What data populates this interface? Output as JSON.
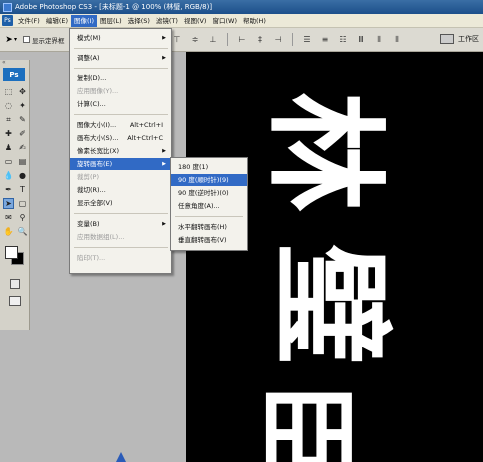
{
  "window": {
    "title": "Adobe Photoshop CS3 - [未标题-1 @ 100% (林璧, RGB/8)]"
  },
  "menubar": {
    "badge": "Ps",
    "items": [
      "文件(F)",
      "编辑(E)",
      "图像(I)",
      "图层(L)",
      "选择(S)",
      "滤镜(T)",
      "视图(V)",
      "窗口(W)",
      "帮助(H)"
    ]
  },
  "options": {
    "checkbox_label": "显示定界框",
    "workspace_label": "工作区"
  },
  "toolbox": {
    "logo": "Ps",
    "grip": "«"
  },
  "image_menu": {
    "items": [
      {
        "label": "模式(M)",
        "shortcut": "",
        "submenu": true,
        "disabled": false
      },
      {
        "label": "调整(A)",
        "shortcut": "",
        "submenu": true,
        "disabled": false
      },
      {
        "label": "复制(D)...",
        "shortcut": "",
        "submenu": false,
        "disabled": false
      },
      {
        "label": "应用图像(Y)...",
        "shortcut": "",
        "submenu": false,
        "disabled": true
      },
      {
        "label": "计算(C)...",
        "shortcut": "",
        "submenu": false,
        "disabled": false
      },
      {
        "label": "图像大小(I)...",
        "shortcut": "Alt+Ctrl+I",
        "submenu": false,
        "disabled": false
      },
      {
        "label": "画布大小(S)...",
        "shortcut": "Alt+Ctrl+C",
        "submenu": false,
        "disabled": false
      },
      {
        "label": "像素长宽比(X)",
        "shortcut": "",
        "submenu": true,
        "disabled": false
      },
      {
        "label": "旋转画布(E)",
        "shortcut": "",
        "submenu": true,
        "disabled": false,
        "active": true
      },
      {
        "label": "裁剪(P)",
        "shortcut": "",
        "submenu": false,
        "disabled": true
      },
      {
        "label": "裁切(R)...",
        "shortcut": "",
        "submenu": false,
        "disabled": false
      },
      {
        "label": "显示全部(V)",
        "shortcut": "",
        "submenu": false,
        "disabled": false
      },
      {
        "label": "变量(B)",
        "shortcut": "",
        "submenu": true,
        "disabled": false
      },
      {
        "label": "应用数据组(L)...",
        "shortcut": "",
        "submenu": false,
        "disabled": true
      },
      {
        "label": "陷印(T)...",
        "shortcut": "",
        "submenu": false,
        "disabled": true
      }
    ]
  },
  "rotate_submenu": {
    "items": [
      {
        "label": "180 度(1)",
        "active": false
      },
      {
        "label": "90 度(顺时针)(9)",
        "active": true
      },
      {
        "label": "90 度(逆时针)(0)",
        "active": false
      },
      {
        "label": "任意角度(A)...",
        "active": false
      },
      {
        "label": "水平翻转画布(H)",
        "active": false
      },
      {
        "label": "垂直翻转画布(V)",
        "active": false
      }
    ]
  },
  "canvas": {
    "chars": [
      "林",
      "璧",
      "臣"
    ]
  },
  "colors": {
    "menu_highlight": "#316ac5",
    "canvas_bg": "#000000",
    "text_fg": "#ffffff"
  }
}
